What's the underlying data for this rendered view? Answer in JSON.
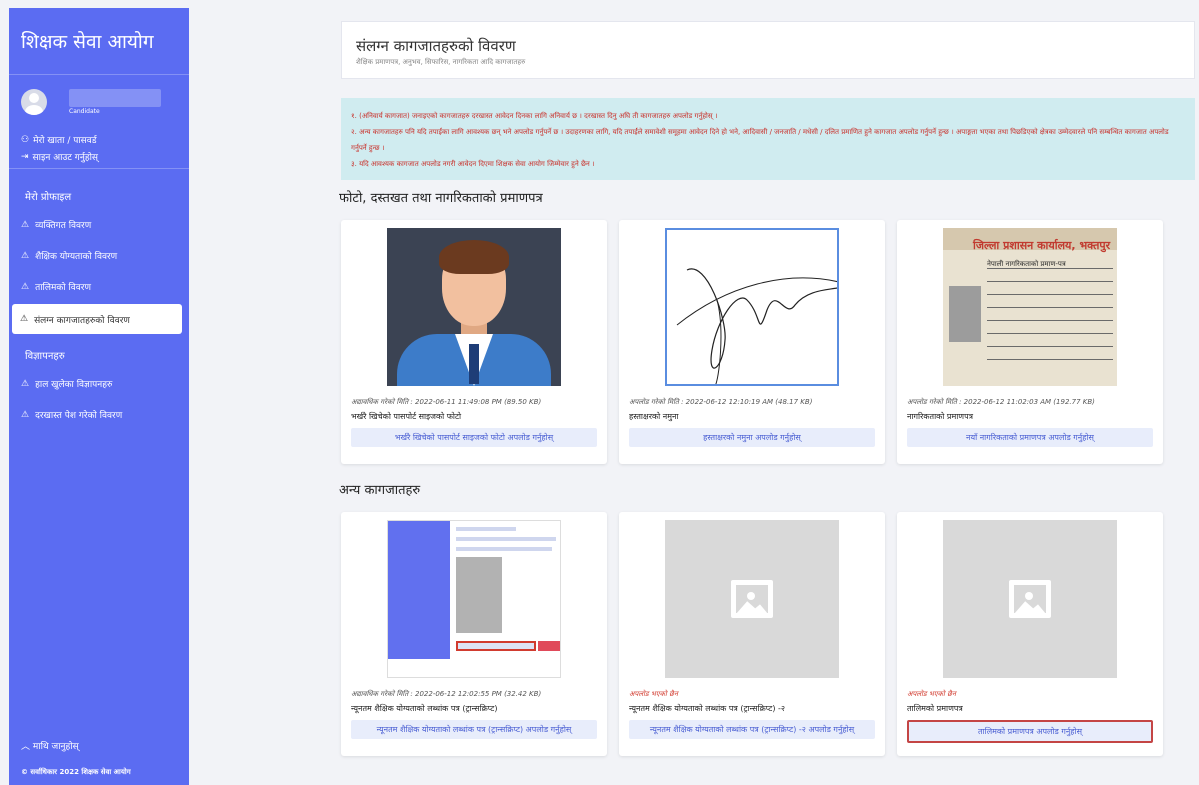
{
  "sidebar": {
    "brand": "शिक्षक सेवा आयोग",
    "user_role": "Candidate",
    "account_link": "मेरो खाता / पासवर्ड",
    "logout_link": "साइन आउट गर्नुहोस्",
    "menu_title": "मेरो प्रोफाइल",
    "items": [
      {
        "label": "व्यक्तिगत विवरण"
      },
      {
        "label": "शैक्षिक योग्यताको विवरण"
      },
      {
        "label": "तालिमको विवरण"
      },
      {
        "label": "संलग्न कागजातहरुको विवरण"
      }
    ],
    "ads_title": "विज्ञापनहरु",
    "ad_items": [
      {
        "label": "हाल खुलेका विज्ञापनहरु"
      },
      {
        "label": "दरखास्त पेश गरेको विवरण"
      }
    ],
    "scroll_top": "माथि जानुहोस्",
    "copyright": "© सर्वाधिकार 2022 शिक्षक सेवा आयोग"
  },
  "page": {
    "title": "संलग्न कागजातहरुको विवरण",
    "subtitle": "शैक्षिक प्रमाणपत्र, अनुभव, सिफारिस, नागरिकता आदि कागजातहरु",
    "notices": [
      "१. (अनिवार्य कागजात) जनाइएको कागजातहरु दरखास्त आवेदन दिनका लागि अनिवार्य छ । दरखास्त दिनु अघि ती कागजातहरु अपलोड गर्नुहोस् ।",
      "२. अन्य कागजातहरु पनि यदि तपाईंका लागि आवश्यक छन् भने अपलोड गर्नुपर्ने छ । उदाहरणका लागि, यदि तपाईंले समावेशी समूहमा आवेदन दिने हो भने, आदिवासी / जनजाति / मधेसी / दलित प्रमाणित हुने कागजात अपलोड गर्नुपर्ने हुन्छ । अपाङ्गता भएका तथा पिछडिएको क्षेत्रका उम्मेदवारले पनि सम्बन्धित कागजात अपलोड गर्नुपर्ने हुन्छ ।",
      "३. यदि आवश्यक कागजात अपलोड नगरी आवेदन दिएमा शिक्षक सेवा आयोग जिम्मेवार हुने छैन ।"
    ],
    "section1_title": "फोटो, दस्तखत तथा नागरिकताको प्रमाणपत्र",
    "section2_title": "अन्य कागजातहरु"
  },
  "cards_top": [
    {
      "meta": "अद्यावधिक गरेको मिति : 2022-06-11 11:49:08 PM (89.50 KB)",
      "name": "भर्खरै खिचेको पासपोर्ट साइजको फोटो",
      "button": "भर्खरै खिचेको पासपोर्ट साइजको फोटो अपलोड गर्नुहोस्"
    },
    {
      "meta": "अपलोड गरेको मिति : 2022-06-12 12:10:19 AM (48.17 KB)",
      "name": "हस्ताक्षरको नमुना",
      "button": "हस्ताक्षरको नमुना अपलोड गर्नुहोस्"
    },
    {
      "meta": "अपलोड गरेको मिति : 2022-06-12 11:02:03 AM (192.77 KB)",
      "name": "नागरिकताको प्रमाणपत्र",
      "button": "नयाँ नागरिकताको प्रमाणपत्र अपलोड गर्नुहोस्"
    }
  ],
  "cards_bottom": [
    {
      "meta": "अद्यावधिक गरेको मिति : 2022-06-12 12:02:55 PM (32.42 KB)",
      "name": "न्यूनतम शैक्षिक योग्यताको लब्धांक पत्र (ट्रान्सक्रिप्ट)",
      "button": "न्यूनतम शैक्षिक योग्यताको लब्धांक पत्र (ट्रान्सक्रिप्ट) अपलोड गर्नुहोस्"
    },
    {
      "meta": "अपलोड भएको छैन",
      "name": "न्यूनतम शैक्षिक योग्यताको लब्धांक पत्र (ट्रान्सक्रिप्ट) -२",
      "button": "न्यूनतम शैक्षिक योग्यताको लब्धांक पत्र (ट्रान्सक्रिप्ट) -२ अपलोड गर्नुहोस्"
    },
    {
      "meta": "अपलोड भएको छैन",
      "name": "तालिमको प्रमाणपत्र",
      "button": "तालिमको प्रमाणपत्र अपलोड गर्नुहोस्"
    }
  ],
  "doc_thumb": {
    "header": "जिल्ला प्रशासन कार्यालय, भक्तपुर",
    "subheader": "नेपाली नागरिकताको प्रमाण-पत्र"
  },
  "colors": {
    "sidebar": "#5b6cf2",
    "notice_bg": "#d0ecf0",
    "notice_text": "#c8302a",
    "button_bg": "#e8edfb",
    "button_text": "#4a5fd3"
  }
}
